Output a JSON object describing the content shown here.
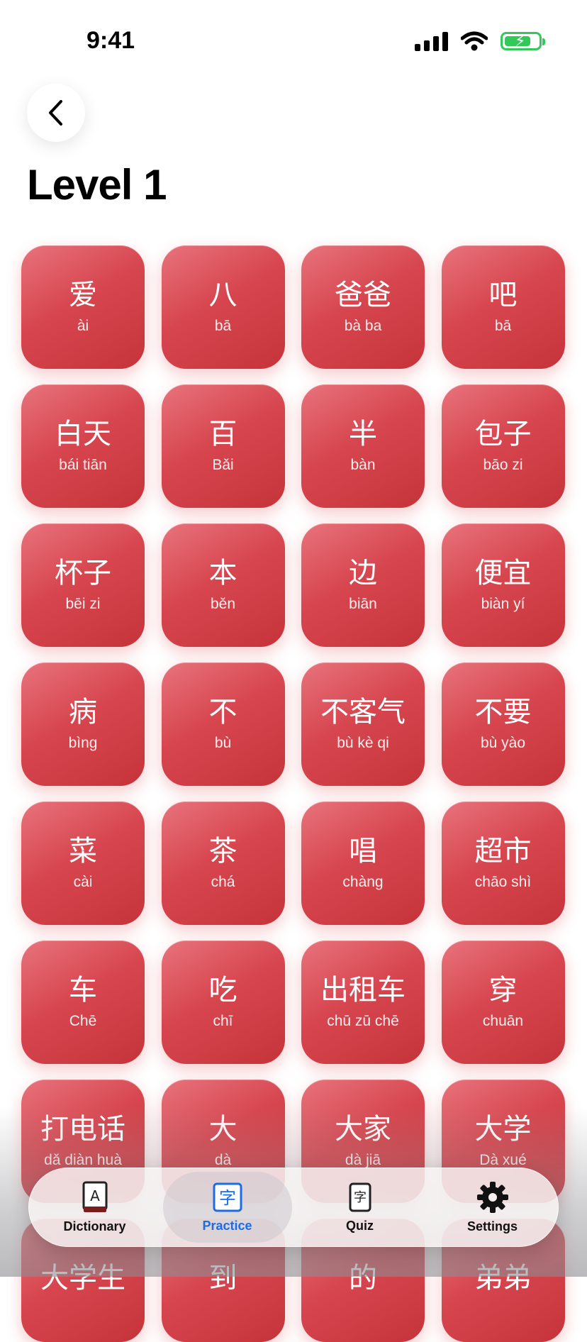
{
  "status_bar": {
    "time": "9:41"
  },
  "header": {
    "title": "Level 1"
  },
  "words": [
    {
      "hanzi": "爱",
      "pinyin": "ài"
    },
    {
      "hanzi": "八",
      "pinyin": "bā"
    },
    {
      "hanzi": "爸爸",
      "pinyin": "bà ba"
    },
    {
      "hanzi": "吧",
      "pinyin": "bā"
    },
    {
      "hanzi": "白天",
      "pinyin": "bái tiān"
    },
    {
      "hanzi": "百",
      "pinyin": "Bǎi"
    },
    {
      "hanzi": "半",
      "pinyin": "bàn"
    },
    {
      "hanzi": "包子",
      "pinyin": "bāo zi"
    },
    {
      "hanzi": "杯子",
      "pinyin": "bēi zi"
    },
    {
      "hanzi": "本",
      "pinyin": "běn"
    },
    {
      "hanzi": "边",
      "pinyin": "biān"
    },
    {
      "hanzi": "便宜",
      "pinyin": "biàn yí"
    },
    {
      "hanzi": "病",
      "pinyin": "bìng"
    },
    {
      "hanzi": "不",
      "pinyin": "bù"
    },
    {
      "hanzi": "不客气",
      "pinyin": "bù kè qi"
    },
    {
      "hanzi": "不要",
      "pinyin": "bù yào"
    },
    {
      "hanzi": "菜",
      "pinyin": "cài"
    },
    {
      "hanzi": "茶",
      "pinyin": "chá"
    },
    {
      "hanzi": "唱",
      "pinyin": "chàng"
    },
    {
      "hanzi": "超市",
      "pinyin": "chāo shì"
    },
    {
      "hanzi": "车",
      "pinyin": "Chē"
    },
    {
      "hanzi": "吃",
      "pinyin": "chī"
    },
    {
      "hanzi": "出租车",
      "pinyin": "chū zū chē"
    },
    {
      "hanzi": "穿",
      "pinyin": "chuān"
    },
    {
      "hanzi": "打电话",
      "pinyin": "dǎ diàn huà"
    },
    {
      "hanzi": "大",
      "pinyin": "dà"
    },
    {
      "hanzi": "大家",
      "pinyin": "dà jiā"
    },
    {
      "hanzi": "大学",
      "pinyin": "Dà xué"
    },
    {
      "hanzi": "大学生",
      "pinyin": ""
    },
    {
      "hanzi": "到",
      "pinyin": ""
    },
    {
      "hanzi": "的",
      "pinyin": ""
    },
    {
      "hanzi": "弟弟",
      "pinyin": ""
    }
  ],
  "tabs": [
    {
      "label": "Dictionary",
      "icon": "dictionary-book-icon",
      "active": false
    },
    {
      "label": "Practice",
      "icon": "practice-character-icon",
      "active": true
    },
    {
      "label": "Quiz",
      "icon": "quiz-card-icon",
      "active": false
    },
    {
      "label": "Settings",
      "icon": "gear-icon",
      "active": false
    }
  ],
  "colors": {
    "card": "#d7464f",
    "accent": "#1d6ce6"
  }
}
